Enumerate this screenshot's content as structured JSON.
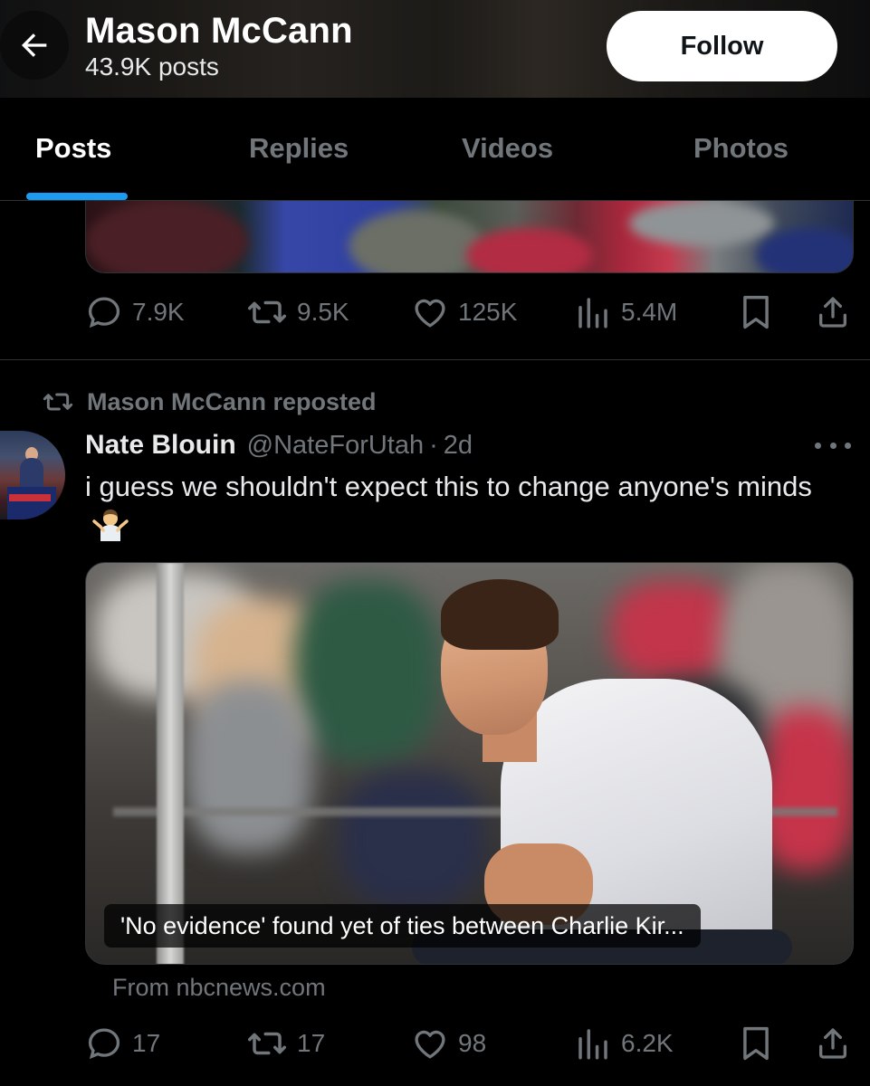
{
  "header": {
    "title": "Mason McCann",
    "post_count": "43.9K posts",
    "follow_label": "Follow"
  },
  "tabs": [
    {
      "label": "Posts",
      "active": true
    },
    {
      "label": "Replies",
      "active": false
    },
    {
      "label": "Videos",
      "active": false
    },
    {
      "label": "Photos",
      "active": false
    }
  ],
  "previous_post": {
    "actions": {
      "replies": "7.9K",
      "reposts": "9.5K",
      "likes": "125K",
      "views": "5.4M"
    }
  },
  "repost": {
    "label": "Mason McCann reposted"
  },
  "post": {
    "author_name": "Nate Blouin",
    "handle": "@NateForUtah",
    "separator": "·",
    "time": "2d",
    "text": "i guess we shouldn't expect this to change anyone's minds",
    "emoji": "person-shrugging",
    "media_caption": "'No evidence' found yet of ties between Charlie Kir...",
    "source": "From nbcnews.com",
    "actions": {
      "replies": "17",
      "reposts": "17",
      "likes": "98",
      "views": "6.2K"
    }
  },
  "icons": {
    "back": "arrow-left-icon",
    "reply": "speech-bubble-icon",
    "repost": "repost-arrows-icon",
    "like": "heart-icon",
    "views": "bar-chart-icon",
    "bookmark": "bookmark-icon",
    "share": "share-upload-icon",
    "more": "ellipsis-icon"
  },
  "colors": {
    "background": "#000000",
    "accent": "#1d9bf0",
    "secondary_text": "#71767b",
    "primary_text": "#e7e9ea"
  }
}
